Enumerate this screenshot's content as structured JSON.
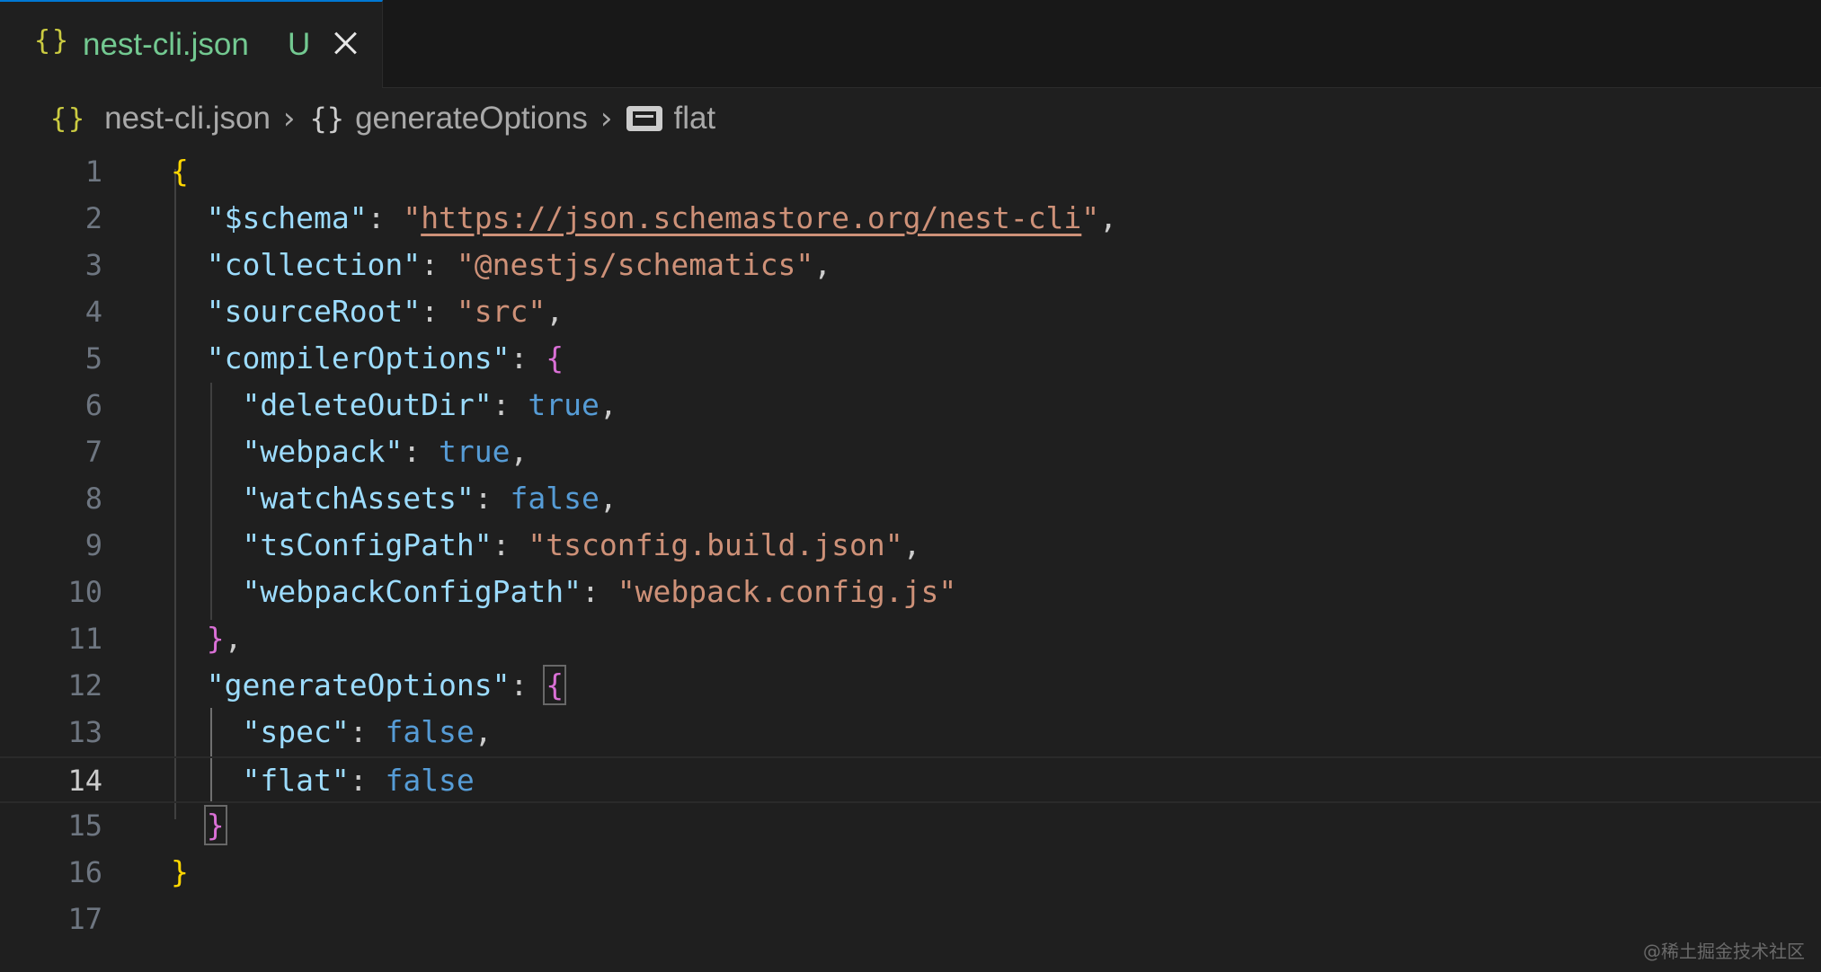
{
  "tab": {
    "icon": "{}",
    "label": "nest-cli.json",
    "status": "U"
  },
  "breadcrumb": {
    "file": "nest-cli.json",
    "object": "generateOptions",
    "property": "flat",
    "file_icon": "{}",
    "object_icon": "{}"
  },
  "editor": {
    "current_line": 14,
    "lines": [
      {
        "n": "1"
      },
      {
        "n": "2"
      },
      {
        "n": "3"
      },
      {
        "n": "4"
      },
      {
        "n": "5"
      },
      {
        "n": "6"
      },
      {
        "n": "7"
      },
      {
        "n": "8"
      },
      {
        "n": "9"
      },
      {
        "n": "10"
      },
      {
        "n": "11"
      },
      {
        "n": "12"
      },
      {
        "n": "13"
      },
      {
        "n": "14"
      },
      {
        "n": "15"
      },
      {
        "n": "16"
      },
      {
        "n": "17"
      }
    ],
    "tokens": {
      "open": "{",
      "close": "}",
      "schema_key": "\"$schema\"",
      "schema_q1": "\"",
      "schema_url": "https://json.schemastore.org/nest-cli",
      "schema_q2": "\"",
      "collection_key": "\"collection\"",
      "collection_val": "\"@nestjs/schematics\"",
      "sourceRoot_key": "\"sourceRoot\"",
      "sourceRoot_val": "\"src\"",
      "compilerOptions_key": "\"compilerOptions\"",
      "deleteOutDir_key": "\"deleteOutDir\"",
      "deleteOutDir_val": "true",
      "webpack_key": "\"webpack\"",
      "webpack_val": "true",
      "watchAssets_key": "\"watchAssets\"",
      "watchAssets_val": "false",
      "tsConfigPath_key": "\"tsConfigPath\"",
      "tsConfigPath_val": "\"tsconfig.build.json\"",
      "webpackConfigPath_key": "\"webpackConfigPath\"",
      "webpackConfigPath_val": "\"webpack.config.js\"",
      "generateOptions_key": "\"generateOptions\"",
      "spec_key": "\"spec\"",
      "spec_val": "false",
      "flat_key": "\"flat\"",
      "flat_val": "false",
      "colon": ": ",
      "comma": ",",
      "close_comma": "},"
    }
  },
  "watermark": "@稀土掘金技术社区",
  "colors": {
    "background": "#1f1f1f",
    "tab_active_border": "#0078d4",
    "untracked_green": "#73c991",
    "json_key": "#9cdcfe",
    "json_string": "#ce9178",
    "json_bool": "#569cd6",
    "bracket_level1": "#ffd700",
    "bracket_level2": "#da70d6"
  }
}
